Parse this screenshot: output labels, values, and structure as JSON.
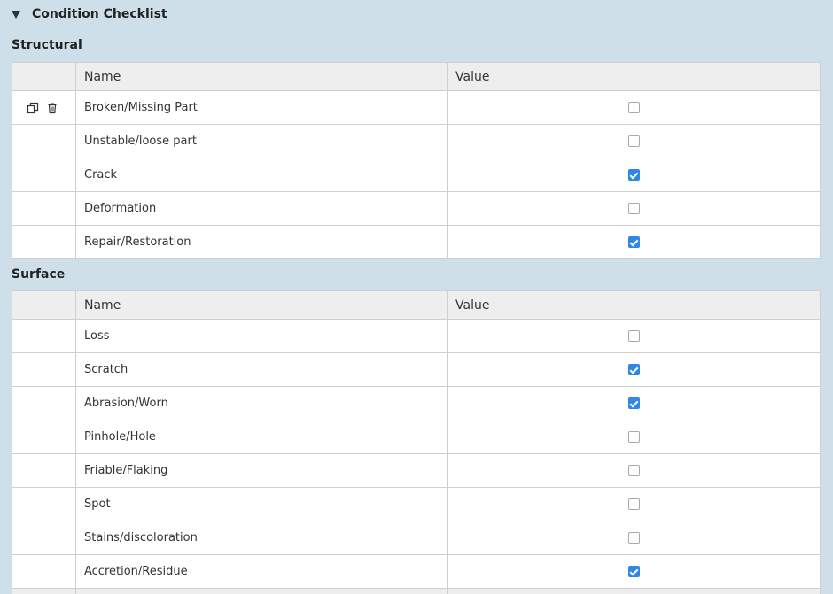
{
  "section": {
    "title": "Condition Checklist"
  },
  "columns": {
    "name": "Name",
    "value": "Value"
  },
  "groups": [
    {
      "title": "Structural",
      "rows": [
        {
          "name": "Broken/Missing Part",
          "checked": false,
          "actions": [
            "copy-icon",
            "trash-icon"
          ]
        },
        {
          "name": "Unstable/loose part",
          "checked": false
        },
        {
          "name": "Crack",
          "checked": true
        },
        {
          "name": "Deformation",
          "checked": false
        },
        {
          "name": "Repair/Restoration",
          "checked": true
        }
      ]
    },
    {
      "title": "Surface",
      "rows": [
        {
          "name": "Loss",
          "checked": false
        },
        {
          "name": "Scratch",
          "checked": true
        },
        {
          "name": "Abrasion/Worn",
          "checked": true
        },
        {
          "name": "Pinhole/Hole",
          "checked": false
        },
        {
          "name": "Friable/Flaking",
          "checked": false
        },
        {
          "name": "Spot",
          "checked": false
        },
        {
          "name": "Stains/discoloration",
          "checked": false
        },
        {
          "name": "Accretion/Residue",
          "checked": true
        }
      ]
    }
  ],
  "colors": {
    "background": "#cfdfe9",
    "checked": "#2f87e8"
  }
}
